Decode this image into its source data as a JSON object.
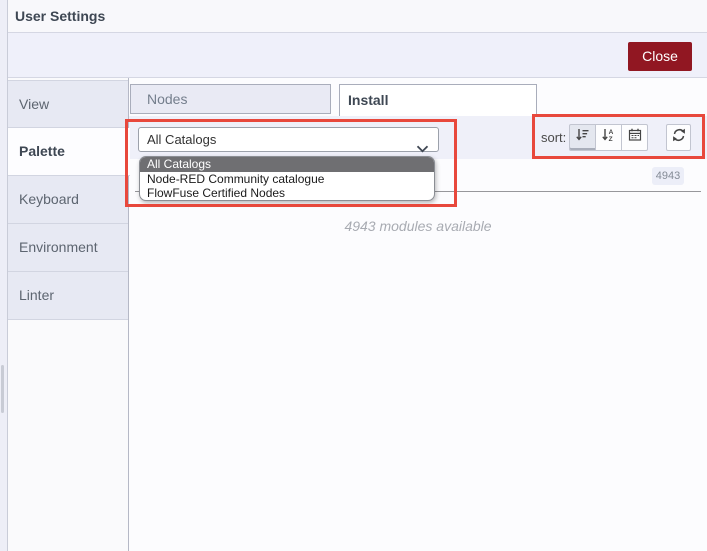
{
  "dialog": {
    "title": "User Settings",
    "close_label": "Close"
  },
  "sidebar": {
    "items": [
      {
        "label": "View"
      },
      {
        "label": "Palette",
        "active": true
      },
      {
        "label": "Keyboard"
      },
      {
        "label": "Environment"
      },
      {
        "label": "Linter"
      }
    ]
  },
  "palette": {
    "tabs": [
      {
        "label": "Nodes"
      },
      {
        "label": "Install",
        "active": true
      }
    ],
    "catalog_select": {
      "value": "All Catalogs",
      "options": [
        "All Catalogs",
        "Node-RED Community catalogue",
        "FlowFuse Certified Nodes"
      ],
      "highlighted_option": "All Catalogs"
    },
    "sort": {
      "label": "sort:",
      "buttons": [
        "sort-order",
        "sort-alpha",
        "sort-date",
        "refresh"
      ],
      "active_button": "sort-order"
    },
    "module_count_badge": "4943",
    "modules_available_text": "4943 modules available"
  },
  "colors": {
    "close_button": "#911722",
    "annotation_red": "#E8483C",
    "highlighted_option_bg": "#6F6F72",
    "toolbar_bg": "#EFF0F9",
    "sidebar_inactive_bg": "#E7E9F3"
  }
}
